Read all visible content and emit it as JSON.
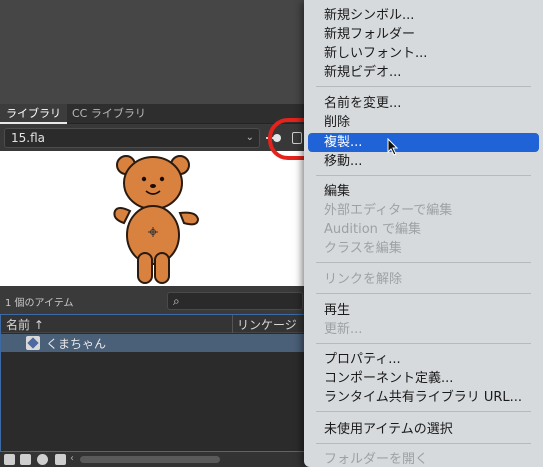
{
  "library": {
    "tabs": [
      "ライブラリ",
      "CC ライブラリ"
    ],
    "document": "15.fla",
    "item_count": "1 個のアイテム",
    "columns": {
      "name": "名前",
      "linkage": "リンケージ"
    },
    "items": [
      {
        "name": "くまちゃん"
      }
    ]
  },
  "menu": {
    "items": [
      {
        "label": "新規シンボル...",
        "enabled": true
      },
      {
        "label": "新規フォルダー",
        "enabled": true
      },
      {
        "label": "新しいフォント...",
        "enabled": true
      },
      {
        "label": "新規ビデオ...",
        "enabled": true
      },
      {
        "label": "名前を変更...",
        "enabled": true
      },
      {
        "label": "削除",
        "enabled": true
      },
      {
        "label": "複製...",
        "enabled": true,
        "selected": true
      },
      {
        "label": "移動...",
        "enabled": true
      },
      {
        "label": "編集",
        "enabled": true
      },
      {
        "label": "外部エディターで編集",
        "enabled": false
      },
      {
        "label": "Audition で編集",
        "enabled": false
      },
      {
        "label": "クラスを編集",
        "enabled": false
      },
      {
        "label": "リンクを解除",
        "enabled": false
      },
      {
        "label": "再生",
        "enabled": true
      },
      {
        "label": "更新...",
        "enabled": false
      },
      {
        "label": "プロパティ...",
        "enabled": true
      },
      {
        "label": "コンポーネント定義...",
        "enabled": true
      },
      {
        "label": "ランタイム共有ライブラリ URL...",
        "enabled": true
      },
      {
        "label": "未使用アイテムの選択",
        "enabled": true
      },
      {
        "label": "フォルダーを開く",
        "enabled": false
      }
    ]
  },
  "colors": {
    "highlight_stroke": "#e3231c",
    "menu_selection": "#1f63d6"
  }
}
